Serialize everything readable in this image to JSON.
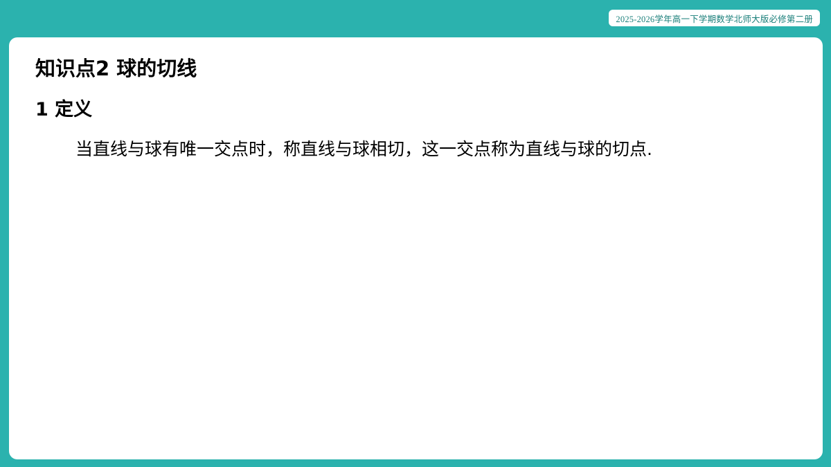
{
  "header": {
    "course_label": "2025-2026学年高一下学期数学北师大版必修第二册"
  },
  "content": {
    "section_title": "知识点2  球的切线",
    "subsection_title": "1  定义",
    "definition": "当直线与球有唯一交点时，称直线与球相切，这一交点称为直线与球的切点."
  },
  "colors": {
    "frame_teal": "#2bb2ae",
    "card_white": "#ffffff",
    "badge_text": "#1a7f7a"
  }
}
